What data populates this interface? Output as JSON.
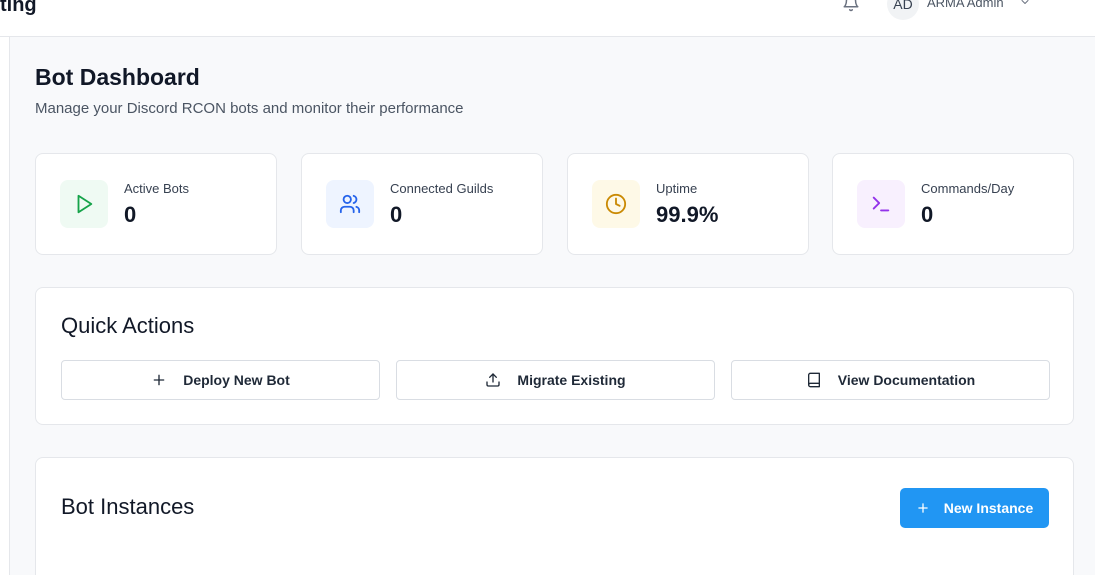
{
  "header": {
    "brand": "ting",
    "avatar_initials": "AD",
    "user_name": "ARMA Admin",
    "icons": [
      "bell-icon",
      "chevron-down-icon"
    ]
  },
  "page": {
    "title": "Bot Dashboard",
    "subtitle": "Manage your Discord RCON bots and monitor their performance"
  },
  "stats": [
    {
      "label": "Active Bots",
      "value": "0",
      "icon": "play-icon",
      "accent": "#16a34a",
      "tint": "#effaf3"
    },
    {
      "label": "Connected Guilds",
      "value": "0",
      "icon": "users-icon",
      "accent": "#2563eb",
      "tint": "#eef4ff"
    },
    {
      "label": "Uptime",
      "value": "99.9%",
      "icon": "clock-icon",
      "accent": "#ca8a04",
      "tint": "#fef9e7"
    },
    {
      "label": "Commands/Day",
      "value": "0",
      "icon": "terminal-icon",
      "accent": "#9333ea",
      "tint": "#f8f0fe"
    }
  ],
  "quick_actions": {
    "title": "Quick Actions",
    "buttons": [
      {
        "label": "Deploy New Bot",
        "icon": "plus-icon"
      },
      {
        "label": "Migrate Existing",
        "icon": "upload-icon"
      },
      {
        "label": "View Documentation",
        "icon": "book-icon"
      }
    ]
  },
  "instances": {
    "title": "Bot Instances",
    "new_button": "New Instance",
    "new_button_icon": "plus-icon",
    "accent": "#2196f3"
  }
}
